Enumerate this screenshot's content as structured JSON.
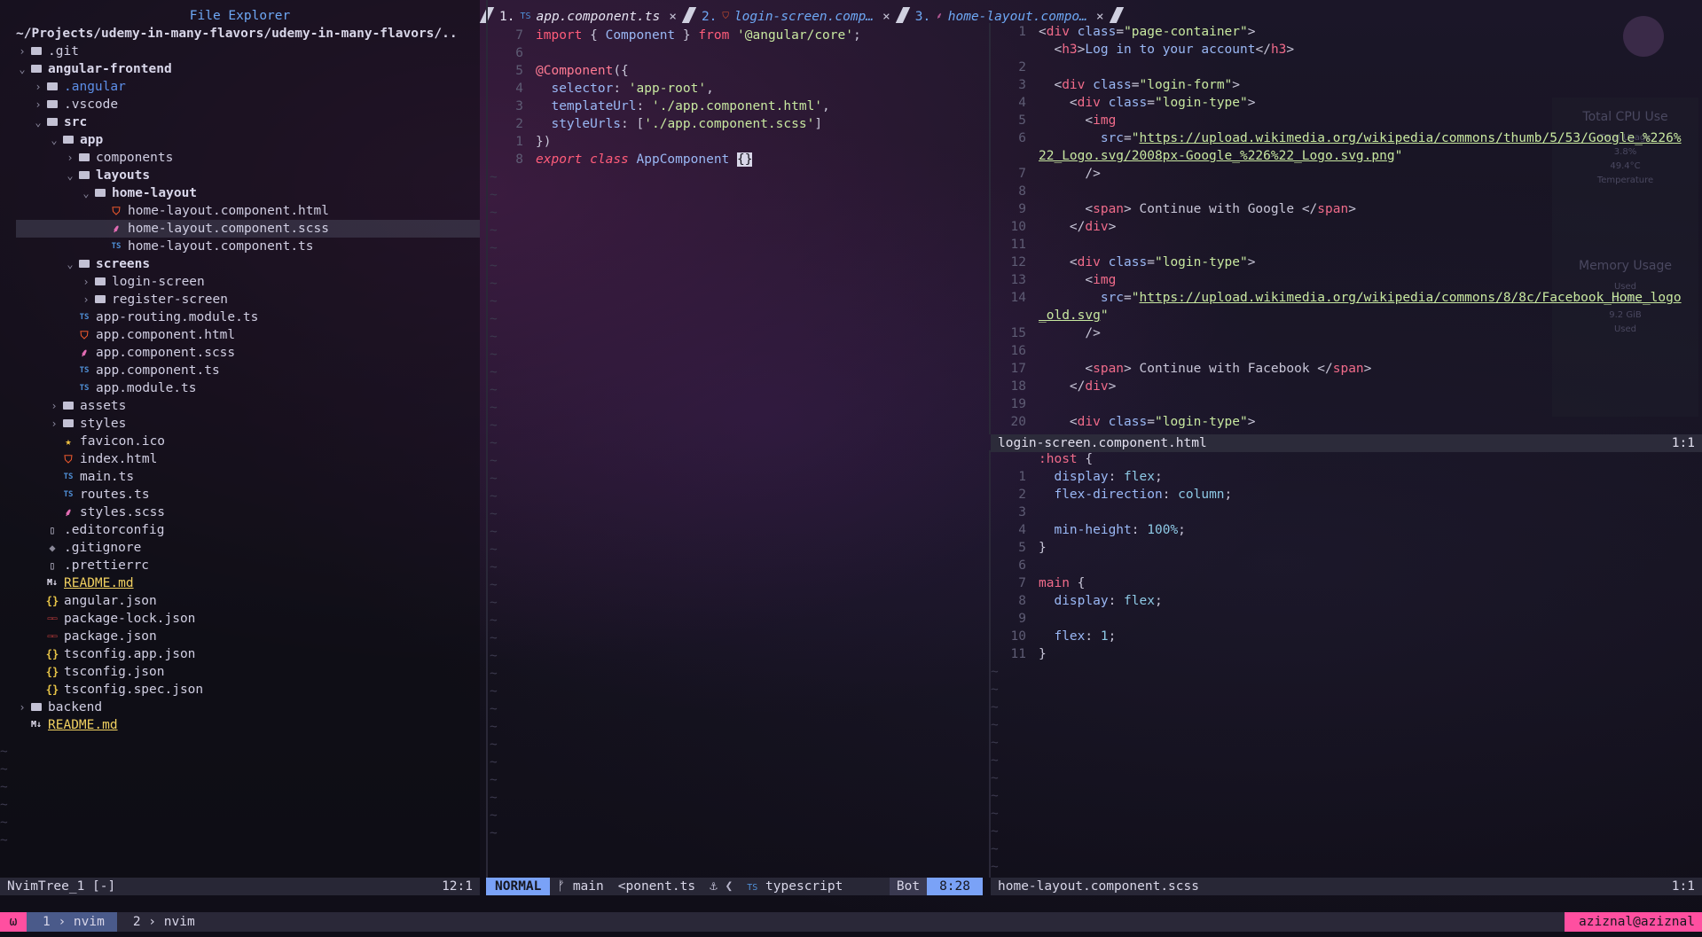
{
  "tree": {
    "title": "File Explorer",
    "root": "~/Projects/udemy-in-many-flavors/udemy-in-many-flavors/..",
    "items": [
      {
        "depth": 0,
        "chev": "›",
        "icon": "folder",
        "name": ".git",
        "style": "dir-plain"
      },
      {
        "depth": 0,
        "chev": "⌄",
        "icon": "folder",
        "name": "angular-frontend",
        "style": "dir"
      },
      {
        "depth": 1,
        "chev": "›",
        "icon": "folder",
        "name": ".angular",
        "style": "blue"
      },
      {
        "depth": 1,
        "chev": "›",
        "icon": "folder",
        "name": ".vscode",
        "style": "plain"
      },
      {
        "depth": 1,
        "chev": "⌄",
        "icon": "folder",
        "name": "src",
        "style": "dir"
      },
      {
        "depth": 2,
        "chev": "⌄",
        "icon": "folder",
        "name": "app",
        "style": "dir"
      },
      {
        "depth": 3,
        "chev": "›",
        "icon": "folder",
        "name": "components",
        "style": "plain"
      },
      {
        "depth": 3,
        "chev": "⌄",
        "icon": "folder",
        "name": "layouts",
        "style": "dir"
      },
      {
        "depth": 4,
        "chev": "⌄",
        "icon": "folder",
        "name": "home-layout",
        "style": "dir"
      },
      {
        "depth": 5,
        "chev": "",
        "icon": "html",
        "name": "home-layout.component.html",
        "style": "plain"
      },
      {
        "depth": 5,
        "chev": "",
        "icon": "scss",
        "name": "home-layout.component.scss",
        "style": "plain",
        "selected": true
      },
      {
        "depth": 5,
        "chev": "",
        "icon": "ts",
        "name": "home-layout.component.ts",
        "style": "plain"
      },
      {
        "depth": 3,
        "chev": "⌄",
        "icon": "folder",
        "name": "screens",
        "style": "dir"
      },
      {
        "depth": 4,
        "chev": "›",
        "icon": "folder",
        "name": "login-screen",
        "style": "plain"
      },
      {
        "depth": 4,
        "chev": "›",
        "icon": "folder",
        "name": "register-screen",
        "style": "plain"
      },
      {
        "depth": 3,
        "chev": "",
        "icon": "ts",
        "name": "app-routing.module.ts",
        "style": "plain"
      },
      {
        "depth": 3,
        "chev": "",
        "icon": "html",
        "name": "app.component.html",
        "style": "plain"
      },
      {
        "depth": 3,
        "chev": "",
        "icon": "scss",
        "name": "app.component.scss",
        "style": "plain"
      },
      {
        "depth": 3,
        "chev": "",
        "icon": "ts",
        "name": "app.component.ts",
        "style": "plain"
      },
      {
        "depth": 3,
        "chev": "",
        "icon": "ts",
        "name": "app.module.ts",
        "style": "plain"
      },
      {
        "depth": 2,
        "chev": "›",
        "icon": "folder",
        "name": "assets",
        "style": "plain"
      },
      {
        "depth": 2,
        "chev": "›",
        "icon": "folder",
        "name": "styles",
        "style": "plain"
      },
      {
        "depth": 2,
        "chev": "",
        "icon": "star",
        "name": "favicon.ico",
        "style": "plain"
      },
      {
        "depth": 2,
        "chev": "",
        "icon": "html",
        "name": "index.html",
        "style": "plain"
      },
      {
        "depth": 2,
        "chev": "",
        "icon": "ts",
        "name": "main.ts",
        "style": "plain"
      },
      {
        "depth": 2,
        "chev": "",
        "icon": "ts",
        "name": "routes.ts",
        "style": "plain"
      },
      {
        "depth": 2,
        "chev": "",
        "icon": "scss",
        "name": "styles.scss",
        "style": "plain"
      },
      {
        "depth": 1,
        "chev": "",
        "icon": "file",
        "name": ".editorconfig",
        "style": "plain"
      },
      {
        "depth": 1,
        "chev": "",
        "icon": "git",
        "name": ".gitignore",
        "style": "plain"
      },
      {
        "depth": 1,
        "chev": "",
        "icon": "file",
        "name": ".prettierrc",
        "style": "plain"
      },
      {
        "depth": 1,
        "chev": "",
        "icon": "md",
        "name": "README.md",
        "style": "yellow"
      },
      {
        "depth": 1,
        "chev": "",
        "icon": "json",
        "name": "angular.json",
        "style": "plain"
      },
      {
        "depth": 1,
        "chev": "",
        "icon": "npm",
        "name": "package-lock.json",
        "style": "plain"
      },
      {
        "depth": 1,
        "chev": "",
        "icon": "npm",
        "name": "package.json",
        "style": "plain"
      },
      {
        "depth": 1,
        "chev": "",
        "icon": "json",
        "name": "tsconfig.app.json",
        "style": "plain"
      },
      {
        "depth": 1,
        "chev": "",
        "icon": "json",
        "name": "tsconfig.json",
        "style": "plain"
      },
      {
        "depth": 1,
        "chev": "",
        "icon": "json",
        "name": "tsconfig.spec.json",
        "style": "plain"
      },
      {
        "depth": 0,
        "chev": "›",
        "icon": "folder",
        "name": "backend",
        "style": "plain"
      },
      {
        "depth": 0,
        "chev": "",
        "icon": "md",
        "name": "README.md",
        "style": "yellow"
      }
    ],
    "status_left": "NvimTree_1 [-]",
    "status_right": "12:1"
  },
  "tabs": [
    {
      "num": "1.",
      "icon": "TS",
      "label": "app.component.ts",
      "close": "×",
      "active": true
    },
    {
      "num": "2.",
      "icon": "html",
      "label": "login-screen.comp…",
      "close": "×",
      "active": false
    },
    {
      "num": "3.",
      "icon": "scss",
      "label": "home-layout.compo…",
      "close": "×",
      "active": false
    }
  ],
  "code1": {
    "lines": [
      {
        "ln": "7",
        "tokens": [
          [
            "k-kw",
            "import"
          ],
          [
            "k-punct",
            " { "
          ],
          [
            "k-ident",
            "Component"
          ],
          [
            "k-punct",
            " } "
          ],
          [
            "k-kw",
            "from"
          ],
          [
            "k-punct",
            " "
          ],
          [
            "k-str",
            "'@angular/core'"
          ],
          [
            "k-punct",
            ";"
          ]
        ]
      },
      {
        "ln": "6",
        "tokens": []
      },
      {
        "ln": "5",
        "tokens": [
          [
            "k-dec",
            "@Component"
          ],
          [
            "k-punct",
            "({"
          ]
        ]
      },
      {
        "ln": "4",
        "tokens": [
          [
            "k-punct",
            "  "
          ],
          [
            "k-prop",
            "selector"
          ],
          [
            "k-punct",
            ": "
          ],
          [
            "k-str",
            "'app-root'"
          ],
          [
            "k-punct",
            ","
          ]
        ]
      },
      {
        "ln": "3",
        "tokens": [
          [
            "k-punct",
            "  "
          ],
          [
            "k-prop",
            "templateUrl"
          ],
          [
            "k-punct",
            ": "
          ],
          [
            "k-str",
            "'./app.component.html'"
          ],
          [
            "k-punct",
            ","
          ]
        ]
      },
      {
        "ln": "2",
        "tokens": [
          [
            "k-punct",
            "  "
          ],
          [
            "k-prop",
            "styleUrls"
          ],
          [
            "k-punct",
            ": ["
          ],
          [
            "k-str",
            "'./app.component.scss'"
          ],
          [
            "k-punct",
            "]"
          ]
        ]
      },
      {
        "ln": "1",
        "tokens": [
          [
            "k-punct",
            "})"
          ]
        ]
      },
      {
        "ln": "8",
        "tokens": [
          [
            "k-kwi",
            "export"
          ],
          [
            "k-punct",
            " "
          ],
          [
            "k-kwi",
            "class"
          ],
          [
            "k-punct",
            " "
          ],
          [
            "k-ident",
            "AppComponent"
          ],
          [
            "k-punct",
            " "
          ],
          [
            "cursor",
            "{}"
          ]
        ]
      }
    ],
    "status": {
      "mode": "NORMAL",
      "branch_icon": "ᚠ",
      "branch": "main",
      "file": "<ponent.ts",
      "icons": "⚓ ❮",
      "ft_icon": "TS",
      "filetype": "typescript",
      "scroll": "Bot",
      "pos": "8:28"
    }
  },
  "code2": {
    "lines": [
      {
        "ln": "1",
        "tokens": [
          [
            "k-punct",
            "<"
          ],
          [
            "k-tag",
            "div"
          ],
          [
            "k-punct",
            " "
          ],
          [
            "k-attr",
            "class"
          ],
          [
            "k-punct",
            "="
          ],
          [
            "k-str",
            "\"page-container\""
          ],
          [
            "k-punct",
            ">"
          ]
        ]
      },
      {
        "ln": "",
        "tokens": [
          [
            "k-punct",
            "  <"
          ],
          [
            "k-tag",
            "h3"
          ],
          [
            "k-punct",
            ">"
          ],
          [
            "k-ident",
            "Log in to your account"
          ],
          [
            "k-punct",
            "</"
          ],
          [
            "k-tag",
            "h3"
          ],
          [
            "k-punct",
            ">"
          ]
        ]
      },
      {
        "ln": "2",
        "tokens": []
      },
      {
        "ln": "3",
        "tokens": [
          [
            "k-punct",
            "  <"
          ],
          [
            "k-tag",
            "div"
          ],
          [
            "k-punct",
            " "
          ],
          [
            "k-attr",
            "class"
          ],
          [
            "k-punct",
            "="
          ],
          [
            "k-str",
            "\"login-form\""
          ],
          [
            "k-punct",
            ">"
          ]
        ]
      },
      {
        "ln": "4",
        "tokens": [
          [
            "k-punct",
            "    <"
          ],
          [
            "k-tag",
            "div"
          ],
          [
            "k-punct",
            " "
          ],
          [
            "k-attr",
            "class"
          ],
          [
            "k-punct",
            "="
          ],
          [
            "k-str",
            "\"login-type\""
          ],
          [
            "k-punct",
            ">"
          ]
        ]
      },
      {
        "ln": "5",
        "tokens": [
          [
            "k-punct",
            "      <"
          ],
          [
            "k-tag",
            "img"
          ]
        ]
      },
      {
        "ln": "6",
        "tokens": [
          [
            "k-punct",
            "        "
          ],
          [
            "k-attr",
            "src"
          ],
          [
            "k-punct",
            "="
          ],
          [
            "k-str",
            "\""
          ],
          [
            "k-link",
            "https://upload.wikimedia.org/wikipedia/commons/thumb/5/53/Google_%226%"
          ]
        ]
      },
      {
        "ln": "",
        "tokens": [
          [
            "k-link",
            "22_Logo.svg/2008px-Google_%226%22_Logo.svg.png"
          ],
          [
            "k-str",
            "\""
          ]
        ]
      },
      {
        "ln": "7",
        "tokens": [
          [
            "k-punct",
            "      />"
          ]
        ]
      },
      {
        "ln": "8",
        "tokens": []
      },
      {
        "ln": "9",
        "tokens": [
          [
            "k-punct",
            "      <"
          ],
          [
            "k-tag",
            "span"
          ],
          [
            "k-punct",
            "> Continue with Google </"
          ],
          [
            "k-tag",
            "span"
          ],
          [
            "k-punct",
            ">"
          ]
        ]
      },
      {
        "ln": "10",
        "tokens": [
          [
            "k-punct",
            "    </"
          ],
          [
            "k-tag",
            "div"
          ],
          [
            "k-punct",
            ">"
          ]
        ]
      },
      {
        "ln": "11",
        "tokens": []
      },
      {
        "ln": "12",
        "tokens": [
          [
            "k-punct",
            "    <"
          ],
          [
            "k-tag",
            "div"
          ],
          [
            "k-punct",
            " "
          ],
          [
            "k-attr",
            "class"
          ],
          [
            "k-punct",
            "="
          ],
          [
            "k-str",
            "\"login-type\""
          ],
          [
            "k-punct",
            ">"
          ]
        ]
      },
      {
        "ln": "13",
        "tokens": [
          [
            "k-punct",
            "      <"
          ],
          [
            "k-tag",
            "img"
          ]
        ]
      },
      {
        "ln": "14",
        "tokens": [
          [
            "k-punct",
            "        "
          ],
          [
            "k-attr",
            "src"
          ],
          [
            "k-punct",
            "="
          ],
          [
            "k-str",
            "\""
          ],
          [
            "k-link",
            "https://upload.wikimedia.org/wikipedia/commons/8/8c/Facebook_Home_logo"
          ]
        ]
      },
      {
        "ln": "",
        "tokens": [
          [
            "k-link",
            "_old.svg"
          ],
          [
            "k-str",
            "\""
          ]
        ]
      },
      {
        "ln": "15",
        "tokens": [
          [
            "k-punct",
            "      />"
          ]
        ]
      },
      {
        "ln": "16",
        "tokens": []
      },
      {
        "ln": "17",
        "tokens": [
          [
            "k-punct",
            "      <"
          ],
          [
            "k-tag",
            "span"
          ],
          [
            "k-punct",
            "> Continue with Facebook </"
          ],
          [
            "k-tag",
            "span"
          ],
          [
            "k-punct",
            ">"
          ]
        ]
      },
      {
        "ln": "18",
        "tokens": [
          [
            "k-punct",
            "    </"
          ],
          [
            "k-tag",
            "div"
          ],
          [
            "k-punct",
            ">"
          ]
        ]
      },
      {
        "ln": "19",
        "tokens": []
      },
      {
        "ln": "20",
        "tokens": [
          [
            "k-punct",
            "    <"
          ],
          [
            "k-tag",
            "div"
          ],
          [
            "k-punct",
            " "
          ],
          [
            "k-attr",
            "class"
          ],
          [
            "k-punct",
            "="
          ],
          [
            "k-str",
            "\"login-type\""
          ],
          [
            "k-punct",
            ">"
          ]
        ]
      }
    ],
    "winbar_left": "login-screen.component.html",
    "winbar_right": "1:1"
  },
  "code3": {
    "lines": [
      {
        "ln": "",
        "tokens": [
          [
            "k-sel",
            ":host"
          ],
          [
            "k-punct",
            " {"
          ]
        ]
      },
      {
        "ln": "1",
        "tokens": [
          [
            "k-punct",
            "  "
          ],
          [
            "k-prop",
            "display"
          ],
          [
            "k-punct",
            ": "
          ],
          [
            "k-val",
            "flex"
          ],
          [
            "k-punct",
            ";"
          ]
        ]
      },
      {
        "ln": "2",
        "tokens": [
          [
            "k-punct",
            "  "
          ],
          [
            "k-prop",
            "flex-direction"
          ],
          [
            "k-punct",
            ": "
          ],
          [
            "k-val",
            "column"
          ],
          [
            "k-punct",
            ";"
          ]
        ]
      },
      {
        "ln": "3",
        "tokens": []
      },
      {
        "ln": "4",
        "tokens": [
          [
            "k-punct",
            "  "
          ],
          [
            "k-prop",
            "min-height"
          ],
          [
            "k-punct",
            ": "
          ],
          [
            "k-val",
            "100%"
          ],
          [
            "k-punct",
            ";"
          ]
        ]
      },
      {
        "ln": "5",
        "tokens": [
          [
            "k-punct",
            "}"
          ]
        ]
      },
      {
        "ln": "6",
        "tokens": []
      },
      {
        "ln": "7",
        "tokens": [
          [
            "k-sel",
            "main"
          ],
          [
            "k-punct",
            " {"
          ]
        ]
      },
      {
        "ln": "8",
        "tokens": [
          [
            "k-punct",
            "  "
          ],
          [
            "k-prop",
            "display"
          ],
          [
            "k-punct",
            ": "
          ],
          [
            "k-val",
            "flex"
          ],
          [
            "k-punct",
            ";"
          ]
        ]
      },
      {
        "ln": "9",
        "tokens": []
      },
      {
        "ln": "10",
        "tokens": [
          [
            "k-punct",
            "  "
          ],
          [
            "k-prop",
            "flex"
          ],
          [
            "k-punct",
            ": "
          ],
          [
            "k-val",
            "1"
          ],
          [
            "k-punct",
            ";"
          ]
        ]
      },
      {
        "ln": "11",
        "tokens": [
          [
            "k-punct",
            "}"
          ]
        ]
      }
    ],
    "status_left": "home-layout.component.scss",
    "status_right": "1:1"
  },
  "tmux": {
    "logo": "ω",
    "windows": [
      {
        "label": "1 › nvim",
        "active": true
      },
      {
        "label": "2 › nvim",
        "active": false
      }
    ],
    "user": "aziznal@aziznal"
  },
  "widget": {
    "cpu_title": "Total CPU Use",
    "cpu_lines": [
      "Total Usage",
      "3.8%",
      "49.4°C",
      "Temperature"
    ],
    "mem_title": "Memory Usage",
    "mem_lines": [
      "Used",
      "29.5%",
      "9.2 GiB",
      "Used"
    ]
  }
}
